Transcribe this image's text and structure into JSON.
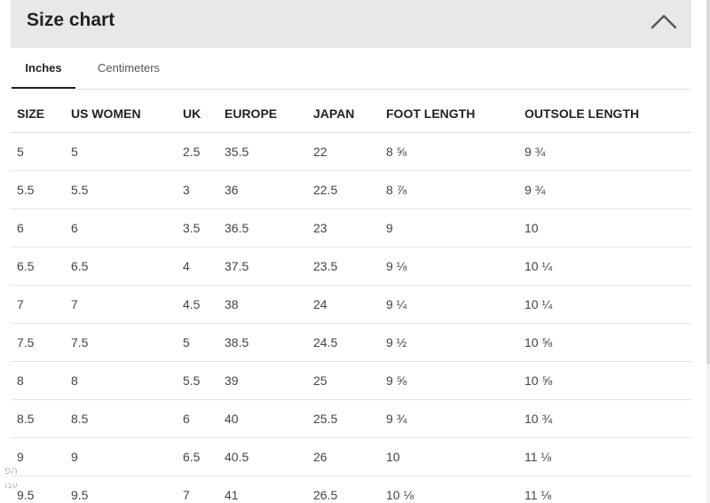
{
  "header": {
    "title": "Size chart"
  },
  "icons": {
    "collapse": "chevron-up-icon"
  },
  "tabs": [
    {
      "label": "Inches",
      "active": true
    },
    {
      "label": "Centimeters",
      "active": false
    }
  ],
  "table": {
    "columns": [
      "SIZE",
      "US WOMEN",
      "UK",
      "EUROPE",
      "JAPAN",
      "FOOT LENGTH",
      "OUTSOLE LENGTH"
    ],
    "rows": [
      [
        "5",
        "5",
        "2.5",
        "35.5",
        "22",
        "8 ⅝",
        "9 ¾"
      ],
      [
        "5.5",
        "5.5",
        "3",
        "36",
        "22.5",
        "8 ⅞",
        "9 ¾"
      ],
      [
        "6",
        "6",
        "3.5",
        "36.5",
        "23",
        "9",
        "10"
      ],
      [
        "6.5",
        "6.5",
        "4",
        "37.5",
        "23.5",
        "9 ⅛",
        "10 ¼"
      ],
      [
        "7",
        "7",
        "4.5",
        "38",
        "24",
        "9 ¼",
        "10 ¼"
      ],
      [
        "7.5",
        "7.5",
        "5",
        "38.5",
        "24.5",
        "9 ½",
        "10 ⅝"
      ],
      [
        "8",
        "8",
        "5.5",
        "39",
        "25",
        "9 ⅝",
        "10 ⅝"
      ],
      [
        "8.5",
        "8.5",
        "6",
        "40",
        "25.5",
        "9 ¾",
        "10 ¾"
      ],
      [
        "9",
        "9",
        "6.5",
        "40.5",
        "26",
        "10",
        "11 ⅛"
      ],
      [
        "9.5",
        "9.5",
        "7",
        "41",
        "26.5",
        "10 ⅛",
        "11 ⅛"
      ]
    ]
  },
  "side_snippet": {
    "line1": "הפ",
    "line2": "עבו"
  },
  "colors": {
    "header_bg": "#e8e8e8",
    "text": "#222222",
    "cell_text": "#444444",
    "divider": "#e6e6e6"
  }
}
